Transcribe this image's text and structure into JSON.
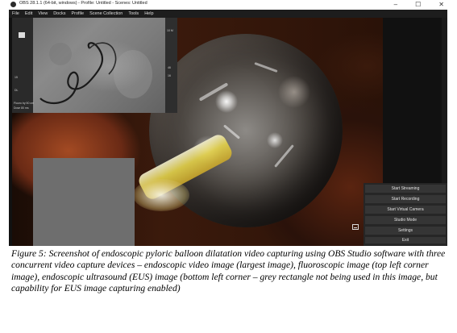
{
  "window": {
    "title": "OBS 28.1.1 (64-bit, windows) - Profile: Untitled - Scenes: Untitled",
    "controls": {
      "minimize": "–",
      "maximize": "☐",
      "close": "✕"
    }
  },
  "menubar": {
    "items": [
      "File",
      "Edit",
      "View",
      "Docks",
      "Profile",
      "Scene Collection",
      "Tools",
      "Help"
    ]
  },
  "controls_dock": {
    "buttons": [
      "Start Streaming",
      "Start Recording",
      "Start Virtual Camera",
      "Studio Mode",
      "Settings",
      "Exit"
    ]
  },
  "fluoro_labels": {
    "top_right": "10 M",
    "right_a": "46",
    "right_b": "16",
    "left_a": "15",
    "left_b": "DL",
    "left_c": "Fluoro by 50 cm",
    "left_d": "Dose 80 ms"
  },
  "caption": "Figure 5: Screenshot of endoscopic pyloric balloon dilatation video capturing using OBS Studio software with three concurrent video capture devices – endoscopic video image (largest image), fluoroscopic image (top left corner image), endoscopic ultrasound (EUS) image (bottom left corner – grey rectangle not being used in this image, but capability for EUS image capturing enabled)"
}
